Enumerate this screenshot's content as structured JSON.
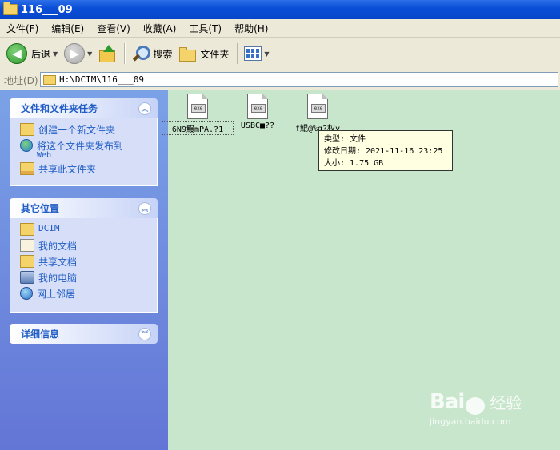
{
  "window": {
    "title": "116___09"
  },
  "menu": [
    "文件(F)",
    "编辑(E)",
    "查看(V)",
    "收藏(A)",
    "工具(T)",
    "帮助(H)"
  ],
  "toolbar": {
    "back_label": "后退",
    "search_label": "搜索",
    "folders_label": "文件夹"
  },
  "address": {
    "label": "地址(D)",
    "path": "H:\\DCIM\\116___09"
  },
  "sidebar": {
    "tasks": {
      "title": "文件和文件夹任务",
      "items": [
        {
          "label": "创建一个新文件夹",
          "icon": "new-folder-icon"
        },
        {
          "label": "将这个文件夹发布到",
          "sub": "Web",
          "icon": "publish-web-icon"
        },
        {
          "label": "共享此文件夹",
          "icon": "share-folder-icon"
        }
      ]
    },
    "places": {
      "title": "其它位置",
      "items": [
        {
          "label": "DCIM",
          "icon": "folder-icon"
        },
        {
          "label": "我的文档",
          "icon": "my-documents-icon"
        },
        {
          "label": "共享文档",
          "icon": "shared-documents-icon"
        },
        {
          "label": "我的电脑",
          "icon": "my-computer-icon"
        },
        {
          "label": "网上邻居",
          "icon": "network-icon"
        }
      ]
    },
    "details": {
      "title": "详细信息"
    }
  },
  "files": [
    {
      "name": "6N9鰻mPA.?1",
      "icon": "unknown-file-icon",
      "selected": true
    },
    {
      "name": "USBC■??",
      "icon": "unknown-file-icon",
      "selected": false
    },
    {
      "name": "f鯤@%g?权y",
      "icon": "unknown-file-icon",
      "selected": false
    }
  ],
  "tooltip": {
    "type_line": "类型: 文件",
    "modified_line": "修改日期: 2021-11-16 23:25",
    "size_line": "大小: 1.75 GB"
  },
  "watermark": {
    "brand": "Bai",
    "brand_suffix": "经验",
    "url": "jingyan.baidu.com"
  },
  "colors": {
    "title_bar": "#0a4fd8",
    "sidebar": "#6f8fe0",
    "content_bg": "#c8e6cc",
    "link": "#215dc6"
  }
}
